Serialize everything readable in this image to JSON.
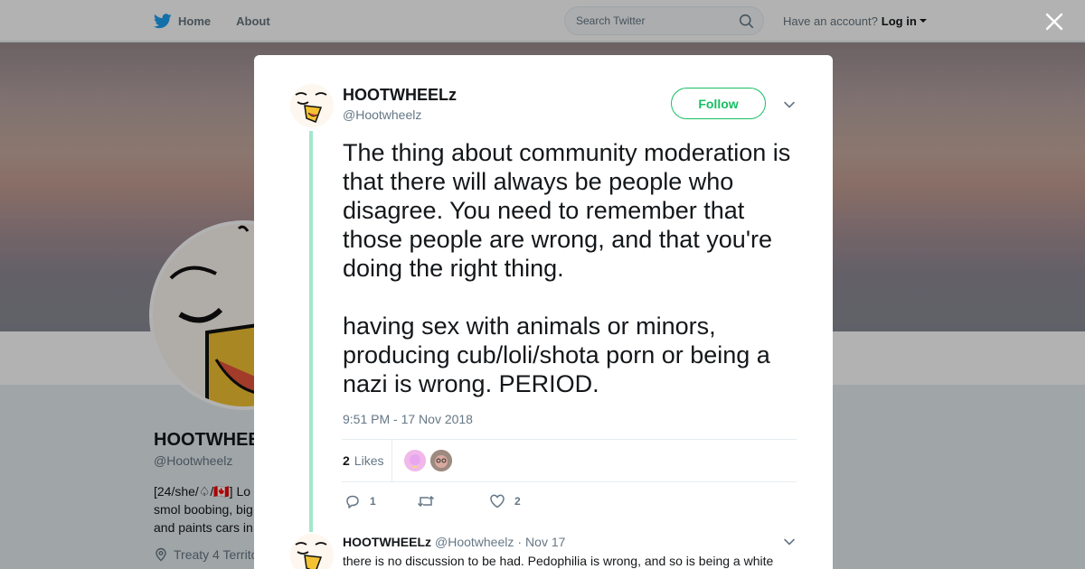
{
  "nav": {
    "home_label": "Home",
    "about_label": "About",
    "search_placeholder": "Search Twitter",
    "have_account": "Have an account?",
    "login_label": "Log in"
  },
  "profile": {
    "name": "HOOTWHEE",
    "handle": "@Hootwheelz",
    "bio_line1": "[24/she/♤/🇨🇦] Lo",
    "bio_line2": "smol boobing, big",
    "bio_line3": "and paints cars in",
    "location": "Treaty 4 Territo"
  },
  "tweet": {
    "author_name": "HOOTWHEELz",
    "author_handle": "@Hootwheelz",
    "follow_label": "Follow",
    "text": "The thing about community moderation is that there will always be people who disagree. You need to remember that those people are wrong, and that you're doing the right thing.\n\nhaving sex with animals or minors, producing cub/loli/shota porn or being a nazi is wrong. PERIOD.",
    "timestamp": "9:51 PM - 17 Nov 2018",
    "likes_count": "2",
    "likes_label": "Likes",
    "reply_count": "1",
    "like_count_action": "2"
  },
  "reply": {
    "author_name": "HOOTWHEELz",
    "author_handle": "@Hootwheelz",
    "date": "Nov 17",
    "separator": "·",
    "text": "there is no discussion to be had. Pedophilia is wrong, and so is being a white"
  },
  "colors": {
    "accent_green": "#17bf63",
    "thread_line": "#a3e6cc",
    "twitter_blue": "#1da1f2"
  },
  "icons": [
    "twitter-bird-icon",
    "search-icon",
    "close-icon",
    "chevron-down-icon",
    "reply-icon",
    "retweet-icon",
    "heart-icon",
    "location-pin-icon"
  ]
}
